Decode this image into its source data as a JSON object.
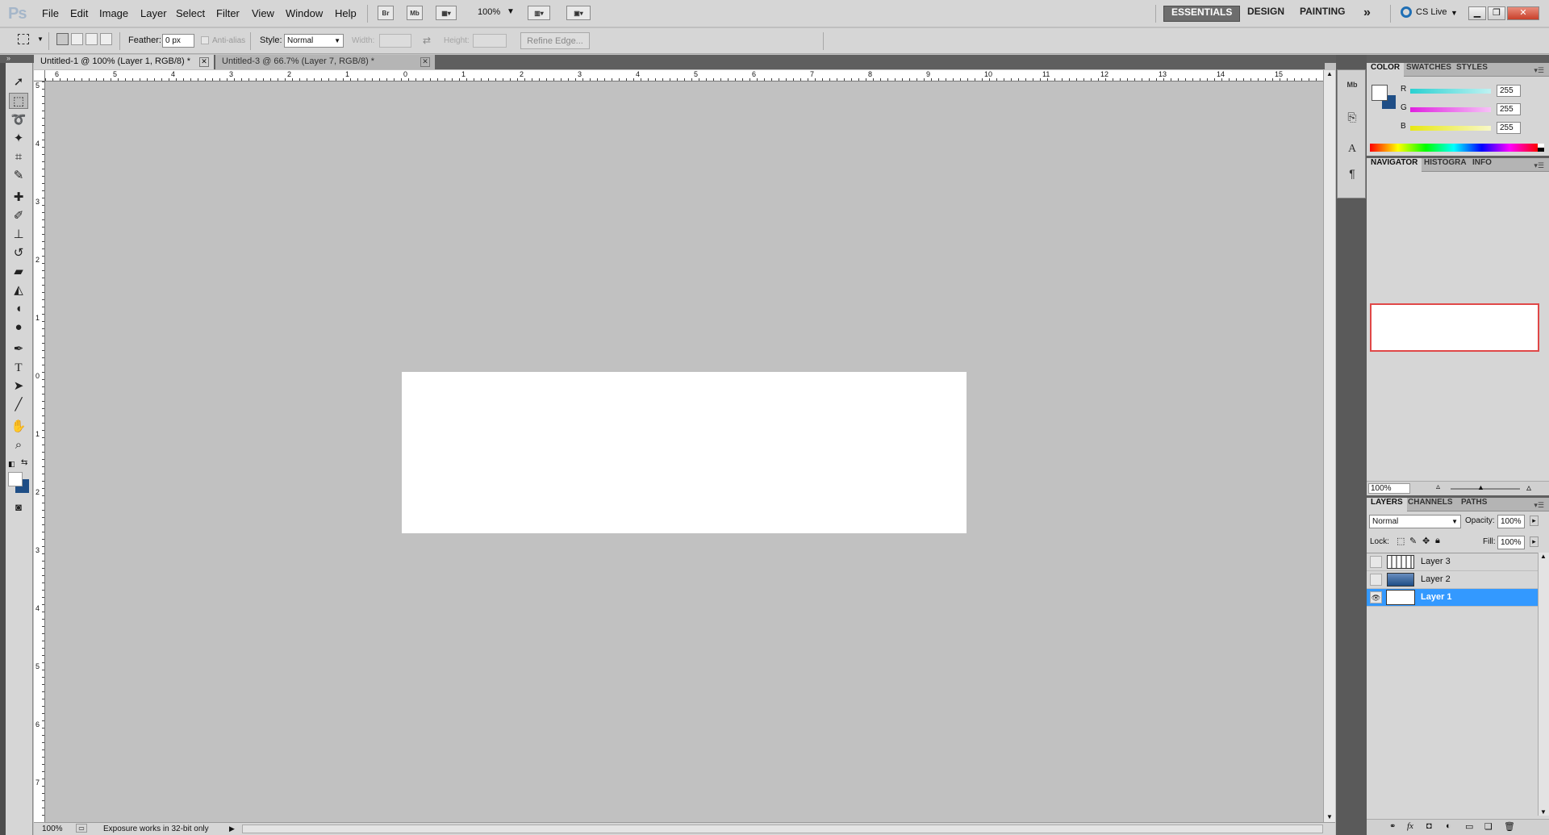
{
  "app": {
    "logo": "Ps"
  },
  "menu": [
    "File",
    "Edit",
    "Image",
    "Layer",
    "Select",
    "Filter",
    "View",
    "Window",
    "Help"
  ],
  "appbar": {
    "bridge": "Br",
    "minibridge": "Mb",
    "zoom": "100%"
  },
  "workspaces": [
    "ESSENTIALS",
    "DESIGN",
    "PAINTING"
  ],
  "workspace_more": "»",
  "cs_live": "CS Live",
  "options": {
    "feather_label": "Feather:",
    "feather_value": "0 px",
    "antialias_label": "Anti-alias",
    "style_label": "Style:",
    "style_value": "Normal",
    "width_label": "Width:",
    "height_label": "Height:",
    "refine_edge": "Refine Edge..."
  },
  "doc_tabs": [
    {
      "label": "Untitled-1 @ 100% (Layer 1, RGB/8) *"
    },
    {
      "label": "Untitled-3 @ 66.7% (Layer 7, RGB/8) *"
    }
  ],
  "ruler_h": [
    "6",
    "5",
    "4",
    "3",
    "2",
    "1",
    "0",
    "1",
    "2",
    "3",
    "4",
    "5",
    "6",
    "7",
    "8",
    "9",
    "10",
    "11",
    "12",
    "13",
    "14",
    "15"
  ],
  "ruler_v": [
    "5",
    "4",
    "3",
    "2",
    "1",
    "0",
    "1",
    "2",
    "3",
    "4",
    "5",
    "6",
    "7"
  ],
  "status": {
    "zoom": "100%",
    "info": "Exposure works in 32-bit only"
  },
  "color_panel": {
    "tabs": [
      "COLOR",
      "SWATCHES",
      "STYLES"
    ],
    "channels": [
      {
        "label": "R",
        "value": "255",
        "color": "#2ad1d1"
      },
      {
        "label": "G",
        "value": "255",
        "color": "#e020e0"
      },
      {
        "label": "B",
        "value": "255",
        "color": "#e8e812"
      }
    ],
    "foreground": "#ffffff",
    "background": "#1f4e86"
  },
  "navigator_panel": {
    "tabs": [
      "NAVIGATOR",
      "HISTOGRAM",
      "INFO"
    ],
    "zoom": "100%"
  },
  "layers_panel": {
    "tabs": [
      "LAYERS",
      "CHANNELS",
      "PATHS"
    ],
    "blend_mode": "Normal",
    "opacity_label": "Opacity:",
    "opacity_value": "100%",
    "lock_label": "Lock:",
    "fill_label": "Fill:",
    "fill_value": "100%",
    "layers": [
      {
        "name": "Layer 3",
        "visible": false,
        "selected": false
      },
      {
        "name": "Layer 2",
        "visible": false,
        "selected": false
      },
      {
        "name": "Layer 1",
        "visible": true,
        "selected": true
      }
    ]
  }
}
